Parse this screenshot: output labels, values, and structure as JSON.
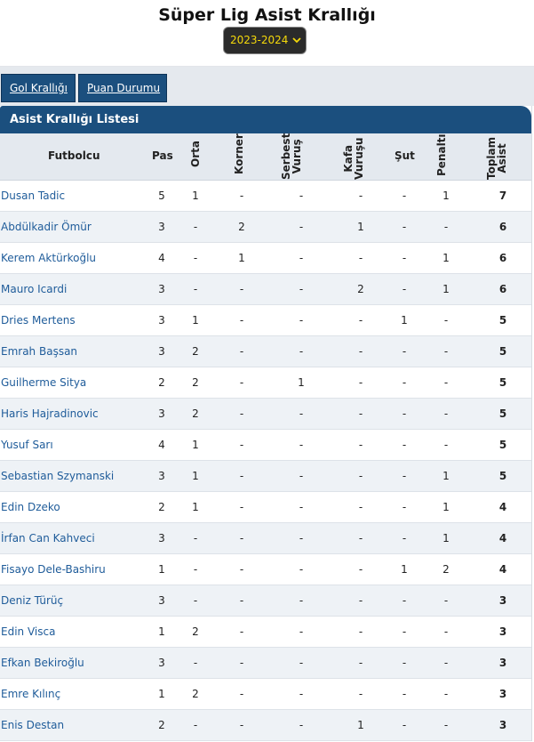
{
  "header": {
    "title": "Süper Lig Asist Krallığı"
  },
  "season": {
    "selected": "2023-2024"
  },
  "tabs": [
    {
      "label": "Gol Krallığı"
    },
    {
      "label": "Puan Durumu"
    }
  ],
  "table": {
    "title": "Asist Krallığı Listesi",
    "columns": {
      "player": "Futbolcu",
      "pas": "Pas",
      "orta": "Orta",
      "korner": "Korner",
      "serbest1": "Serbest",
      "serbest2": "Vuruş",
      "kafa1": "Kafa",
      "kafa2": "Vuruşu",
      "sut": "Şut",
      "penalti": "Penaltı",
      "toplam1": "Toplam",
      "toplam2": "Asist"
    },
    "rows": [
      {
        "player": "Dusan Tadic",
        "pas": "5",
        "orta": "1",
        "korner": "-",
        "serbest": "-",
        "kafa": "-",
        "sut": "-",
        "penalti": "1",
        "toplam": "7"
      },
      {
        "player": "Abdülkadir Ömür",
        "pas": "3",
        "orta": "-",
        "korner": "2",
        "serbest": "-",
        "kafa": "1",
        "sut": "-",
        "penalti": "-",
        "toplam": "6"
      },
      {
        "player": "Kerem Aktürkoğlu",
        "pas": "4",
        "orta": "-",
        "korner": "1",
        "serbest": "-",
        "kafa": "-",
        "sut": "-",
        "penalti": "1",
        "toplam": "6"
      },
      {
        "player": "Mauro Icardi",
        "pas": "3",
        "orta": "-",
        "korner": "-",
        "serbest": "-",
        "kafa": "2",
        "sut": "-",
        "penalti": "1",
        "toplam": "6"
      },
      {
        "player": "Dries Mertens",
        "pas": "3",
        "orta": "1",
        "korner": "-",
        "serbest": "-",
        "kafa": "-",
        "sut": "1",
        "penalti": "-",
        "toplam": "5"
      },
      {
        "player": "Emrah Başsan",
        "pas": "3",
        "orta": "2",
        "korner": "-",
        "serbest": "-",
        "kafa": "-",
        "sut": "-",
        "penalti": "-",
        "toplam": "5"
      },
      {
        "player": "Guilherme Sitya",
        "pas": "2",
        "orta": "2",
        "korner": "-",
        "serbest": "1",
        "kafa": "-",
        "sut": "-",
        "penalti": "-",
        "toplam": "5"
      },
      {
        "player": "Haris Hajradinovic",
        "pas": "3",
        "orta": "2",
        "korner": "-",
        "serbest": "-",
        "kafa": "-",
        "sut": "-",
        "penalti": "-",
        "toplam": "5"
      },
      {
        "player": "Yusuf Sarı",
        "pas": "4",
        "orta": "1",
        "korner": "-",
        "serbest": "-",
        "kafa": "-",
        "sut": "-",
        "penalti": "-",
        "toplam": "5"
      },
      {
        "player": "Sebastian Szymanski",
        "pas": "3",
        "orta": "1",
        "korner": "-",
        "serbest": "-",
        "kafa": "-",
        "sut": "-",
        "penalti": "1",
        "toplam": "5"
      },
      {
        "player": "Edin Dzeko",
        "pas": "2",
        "orta": "1",
        "korner": "-",
        "serbest": "-",
        "kafa": "-",
        "sut": "-",
        "penalti": "1",
        "toplam": "4"
      },
      {
        "player": "İrfan Can Kahveci",
        "pas": "3",
        "orta": "-",
        "korner": "-",
        "serbest": "-",
        "kafa": "-",
        "sut": "-",
        "penalti": "1",
        "toplam": "4"
      },
      {
        "player": "Fisayo Dele-Bashiru",
        "pas": "1",
        "orta": "-",
        "korner": "-",
        "serbest": "-",
        "kafa": "-",
        "sut": "1",
        "penalti": "2",
        "toplam": "4"
      },
      {
        "player": "Deniz Türüç",
        "pas": "3",
        "orta": "-",
        "korner": "-",
        "serbest": "-",
        "kafa": "-",
        "sut": "-",
        "penalti": "-",
        "toplam": "3"
      },
      {
        "player": "Edin Visca",
        "pas": "1",
        "orta": "2",
        "korner": "-",
        "serbest": "-",
        "kafa": "-",
        "sut": "-",
        "penalti": "-",
        "toplam": "3"
      },
      {
        "player": "Efkan Bekiroğlu",
        "pas": "3",
        "orta": "-",
        "korner": "-",
        "serbest": "-",
        "kafa": "-",
        "sut": "-",
        "penalti": "-",
        "toplam": "3"
      },
      {
        "player": "Emre Kılınç",
        "pas": "1",
        "orta": "2",
        "korner": "-",
        "serbest": "-",
        "kafa": "-",
        "sut": "-",
        "penalti": "-",
        "toplam": "3"
      },
      {
        "player": "Enis Destan",
        "pas": "2",
        "orta": "-",
        "korner": "-",
        "serbest": "-",
        "kafa": "1",
        "sut": "-",
        "penalti": "-",
        "toplam": "3"
      }
    ]
  }
}
